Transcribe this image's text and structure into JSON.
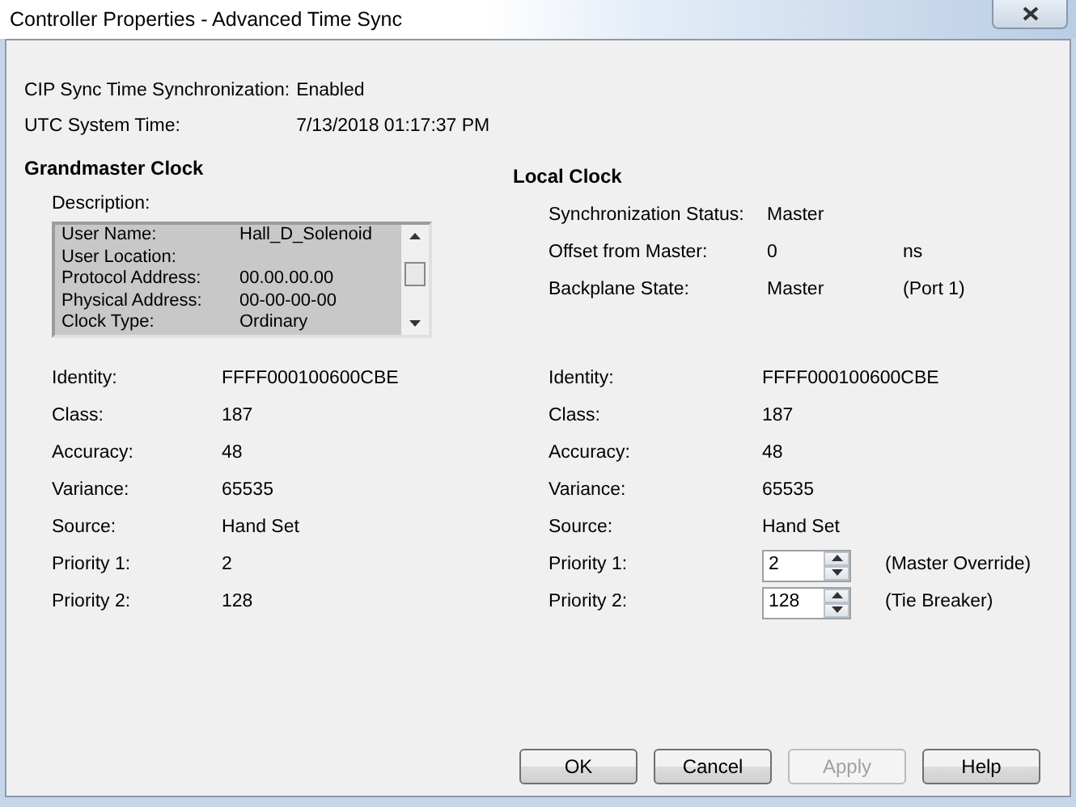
{
  "window": {
    "title": "Controller Properties - Advanced Time Sync"
  },
  "summary": [
    {
      "label": "CIP Sync Time Synchronization:",
      "value": "Enabled"
    },
    {
      "label": "UTC System Time:",
      "value": "7/13/2018 01:17:37 PM"
    }
  ],
  "grandmaster": {
    "heading": "Grandmaster Clock",
    "description_label": "Description:",
    "description": [
      {
        "label": "User Name:",
        "value": "Hall_D_Solenoid"
      },
      {
        "label": "User Location:"
      },
      {
        "label": "Protocol Address:",
        "value": "00.00.00.00"
      },
      {
        "label": "Physical Address:",
        "value": "00-00-00-00"
      },
      {
        "label": "Clock Type:",
        "value": "Ordinary"
      }
    ],
    "fields": [
      {
        "label": "Identity:",
        "value": "FFFF000100600CBE"
      },
      {
        "label": "Class:",
        "value": "187"
      },
      {
        "label": "Accuracy:",
        "value": "48"
      },
      {
        "label": "Variance:",
        "value": "65535"
      },
      {
        "label": "Source:",
        "value": "Hand Set"
      },
      {
        "label": "Priority 1:",
        "value": "2"
      },
      {
        "label": "Priority 2:",
        "value": "128"
      }
    ]
  },
  "local": {
    "heading": "Local Clock",
    "status": [
      {
        "label": "Synchronization Status:",
        "value": "Master"
      },
      {
        "label": "Offset from Master:",
        "value": "0",
        "unit": "ns"
      },
      {
        "label": "Backplane State:",
        "value": "Master",
        "unit": "(Port 1)"
      }
    ],
    "fields": [
      {
        "kind": "text",
        "label": "Identity:",
        "value": "FFFF000100600CBE"
      },
      {
        "kind": "text",
        "label": "Class:",
        "value": "187"
      },
      {
        "kind": "text",
        "label": "Accuracy:",
        "value": "48"
      },
      {
        "kind": "text",
        "label": "Variance:",
        "value": "65535"
      },
      {
        "kind": "text",
        "label": "Source:",
        "value": "Hand Set"
      },
      {
        "kind": "spin",
        "label": "Priority 1:",
        "value": "2",
        "note": "(Master Override)"
      },
      {
        "kind": "spin",
        "label": "Priority 2:",
        "value": "128",
        "note": "(Tie Breaker)"
      }
    ]
  },
  "buttons": [
    {
      "label": "OK",
      "disabled": false
    },
    {
      "label": "Cancel",
      "disabled": false
    },
    {
      "label": "Apply",
      "disabled": true
    },
    {
      "label": "Help",
      "disabled": false
    }
  ]
}
